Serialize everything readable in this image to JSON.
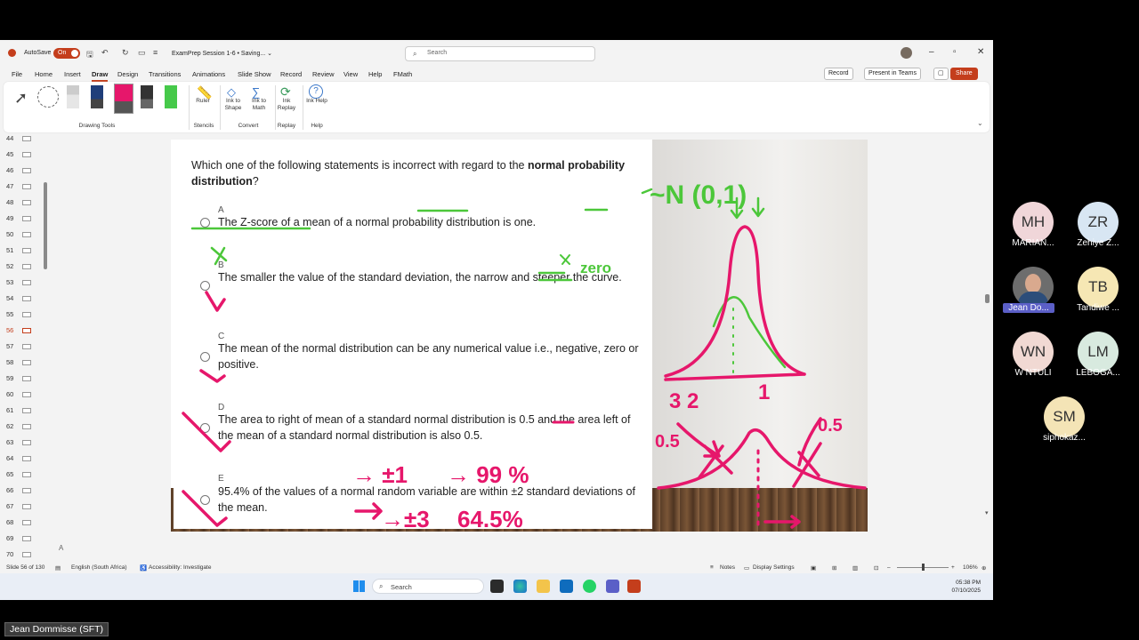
{
  "app": {
    "autosave_label": "AutoSave",
    "autosave_state": "On",
    "doc_title": "ExamPrep Session 1-6 • Saving... ⌄",
    "search_placeholder": "Search",
    "accent": "#c43e1c"
  },
  "tabs": [
    "File",
    "Home",
    "Insert",
    "Draw",
    "Design",
    "Transitions",
    "Animations",
    "Slide Show",
    "Record",
    "Review",
    "View",
    "Help",
    "FMath"
  ],
  "active_tab": "Draw",
  "header_buttons": {
    "record": "Record",
    "present": "Present in Teams",
    "share": "Share"
  },
  "ribbon": {
    "groups": [
      "Drawing Tools",
      "Stencils",
      "Convert",
      "Replay",
      "Help"
    ],
    "tools": {
      "ruler": "Ruler",
      "ink_to_shape": "Ink to Shape",
      "ink_to_math": "Ink to Math",
      "ink_replay": "Ink Replay",
      "ink_help": "Ink Help"
    }
  },
  "thumbnails": [
    "44",
    "45",
    "46",
    "47",
    "48",
    "49",
    "50",
    "51",
    "52",
    "53",
    "54",
    "55",
    "56",
    "57",
    "58",
    "59",
    "60",
    "61",
    "62",
    "63",
    "64",
    "65",
    "66",
    "67",
    "68",
    "69",
    "70"
  ],
  "active_slide_num": "56",
  "slide": {
    "question_parts": {
      "p1": "Which one of the following statements is ",
      "incorrect": "incorrect",
      "p2": " with regard to the ",
      "bold": "normal probability distribution",
      "end": "?"
    },
    "options": [
      {
        "letter": "A",
        "text": "The Z-score of a mean of a normal probability distribution is one."
      },
      {
        "letter": "B",
        "text": "The smaller the value of the standard deviation, the narrow and steeper the curve."
      },
      {
        "letter": "C",
        "text": "The mean of the normal distribution can be any numerical value i.e., negative, zero or positive."
      },
      {
        "letter": "D",
        "text": "The area to right of mean of a standard normal distribution is 0.5 and the area left of the mean of a standard normal distribution is also 0.5."
      },
      {
        "letter": "E",
        "text": "95.4% of the values of a normal random variable are within ±2 standard deviations of the mean."
      }
    ],
    "ink": {
      "zero": "zero",
      "n01": "~N (0,1)",
      "left_labels": "3  2",
      "right_label": "1",
      "half_left": "0.5",
      "half_right": "0.5",
      "pm1": "→ ±1",
      "pct99": "→ 99 %",
      "pm3": "→±3",
      "pct645": "64.5%"
    }
  },
  "notes_placeholder": "A",
  "status": {
    "slide_of": "Slide 56 of 130",
    "language": "English (South Africa)",
    "accessibility": "Accessibility: Investigate",
    "notes": "Notes",
    "display_settings": "Display Settings",
    "zoom": "106%"
  },
  "taskbar": {
    "search_placeholder": "Search",
    "time": "05:38 PM",
    "date": "07/10/2025"
  },
  "participants": [
    {
      "initials": "MH",
      "name": "MARIAN...",
      "color": "#f0d6d9"
    },
    {
      "initials": "ZR",
      "name": "Zehiye Z...",
      "color": "#d8e6f3"
    },
    {
      "initials": "",
      "name": "Jean Do...",
      "color": "#6d6d6d"
    },
    {
      "initials": "TB",
      "name": "Tandiwe ...",
      "color": "#f6e7b4"
    },
    {
      "initials": "WN",
      "name": "W NTULI",
      "color": "#f1d9d3"
    },
    {
      "initials": "LM",
      "name": "LEBOGA...",
      "color": "#d8eadf"
    },
    {
      "initials": "SM",
      "name": "siphokaz...",
      "color": "#f4e4b6"
    }
  ],
  "presenter_name": "Jean Dommisse (SFT)"
}
